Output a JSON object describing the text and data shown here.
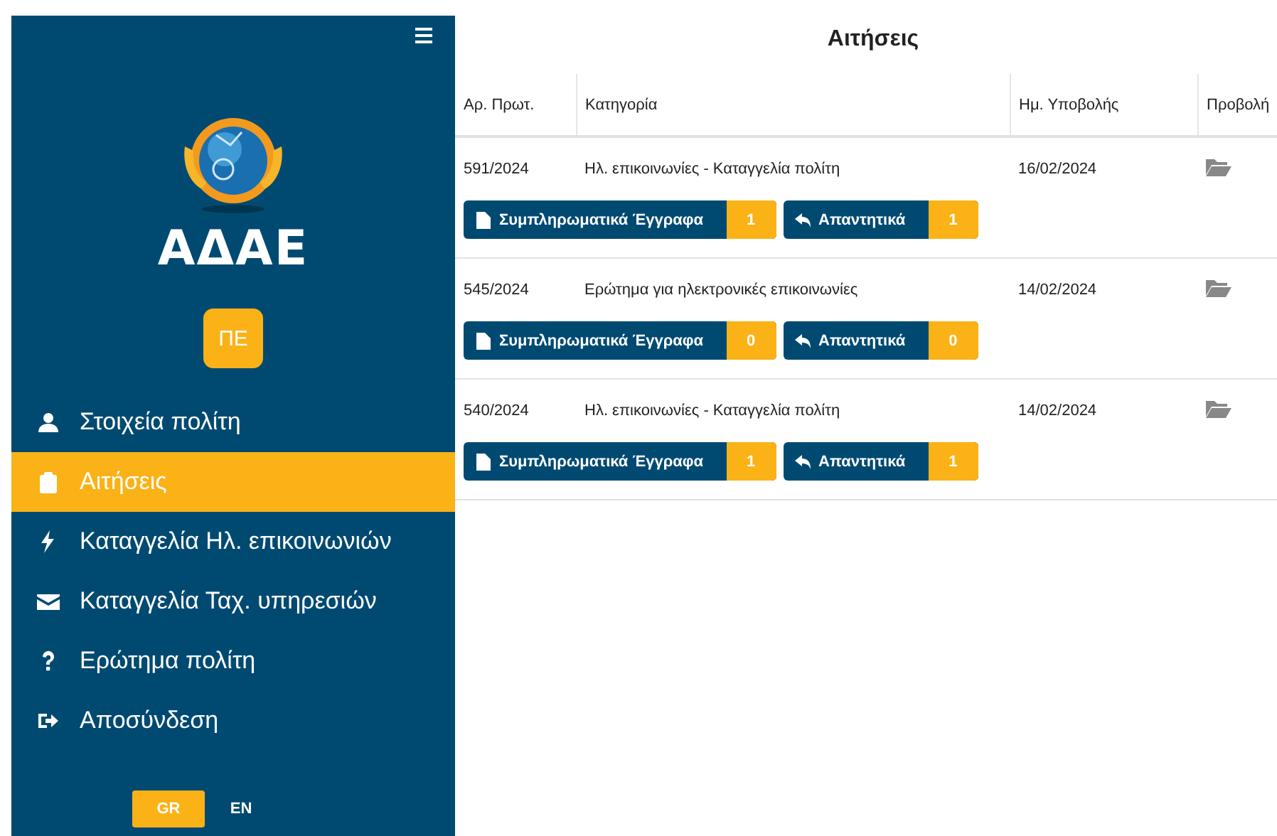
{
  "sidebar": {
    "logo_text": "ΑΔΑΕ",
    "avatar": "ΠΕ",
    "items": [
      {
        "label": "Στοιχεία πολίτη",
        "kind": "user",
        "selected": false
      },
      {
        "label": "Αιτήσεις",
        "kind": "clipboard",
        "selected": true
      },
      {
        "label": "Καταγγελία Ηλ. επικοινωνιών",
        "kind": "bolt",
        "selected": false
      },
      {
        "label": "Καταγγελία Ταχ. υπηρεσιών",
        "kind": "mail",
        "selected": false
      },
      {
        "label": "Ερώτημα πολίτη",
        "kind": "question",
        "selected": false
      },
      {
        "label": "Αποσύνδεση",
        "kind": "logout",
        "selected": false
      }
    ],
    "languages": [
      {
        "label": "GR",
        "selected": true
      },
      {
        "label": "EN",
        "selected": false
      }
    ]
  },
  "main": {
    "title": "Αιτήσεις",
    "table": {
      "columns": [
        "Αρ. Πρωτ.",
        "Κατηγορία",
        "Ημ. Υποβολής",
        "Προβολή"
      ],
      "rows": [
        {
          "number": "591/2024",
          "category": "Ηλ. επικοινωνίες - Καταγγελία πολίτη",
          "date": "16/02/2024",
          "docs_label": "Συμπληρωματικά Έγγραφα",
          "docs_count": "1",
          "replies_label": "Απαντητικά",
          "replies_count": "1"
        },
        {
          "number": "545/2024",
          "category": "Ερώτημα για ηλεκτρονικές επικοινωνίες",
          "date": "14/02/2024",
          "docs_label": "Συμπληρωματικά Έγγραφα",
          "docs_count": "0",
          "replies_label": "Απαντητικά",
          "replies_count": "0"
        },
        {
          "number": "540/2024",
          "category": "Ηλ. επικοινωνίες - Καταγγελία πολίτη",
          "date": "14/02/2024",
          "docs_label": "Συμπληρωματικά Έγγραφα",
          "docs_count": "1",
          "replies_label": "Απαντητικά",
          "replies_count": "1"
        }
      ]
    }
  }
}
